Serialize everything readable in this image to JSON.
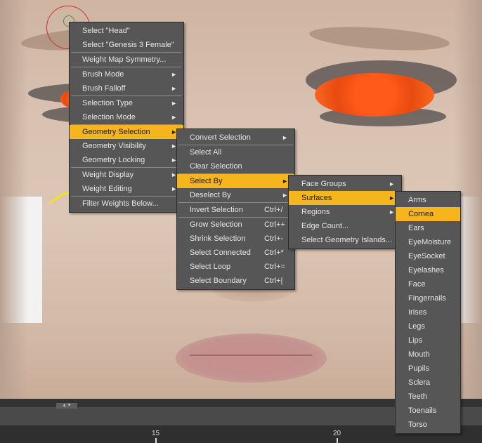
{
  "menu1": {
    "items": [
      {
        "label": "Select \"Head\"",
        "arrow": ""
      },
      {
        "label": "Select \"Genesis 3 Female\"",
        "arrow": ""
      },
      {
        "label": "Weight Map Symmetry...",
        "arrow": ""
      },
      {
        "label": "Brush Mode",
        "arrow": "►"
      },
      {
        "label": "Brush Falloff",
        "arrow": "►"
      },
      {
        "label": "Selection Type",
        "arrow": "►"
      },
      {
        "label": "Selection Mode",
        "arrow": "►"
      },
      {
        "label": "Geometry Selection",
        "arrow": "►"
      },
      {
        "label": "Geometry Visibility",
        "arrow": "►"
      },
      {
        "label": "Geometry Locking",
        "arrow": "►"
      },
      {
        "label": "Weight Display",
        "arrow": "►"
      },
      {
        "label": "Weight Editing",
        "arrow": "►"
      },
      {
        "label": "Filter Weights Below...",
        "arrow": ""
      }
    ]
  },
  "menu2": {
    "items": [
      {
        "label": "Convert Selection",
        "arrow": "►",
        "shortcut": ""
      },
      {
        "label": "Select All",
        "arrow": "",
        "shortcut": ""
      },
      {
        "label": "Clear Selection",
        "arrow": "",
        "shortcut": ""
      },
      {
        "label": "Select By",
        "arrow": "►",
        "shortcut": ""
      },
      {
        "label": "Deselect By",
        "arrow": "►",
        "shortcut": ""
      },
      {
        "label": "Invert Selection",
        "arrow": "",
        "shortcut": "Ctrl+/"
      },
      {
        "label": "Grow Selection",
        "arrow": "",
        "shortcut": "Ctrl++"
      },
      {
        "label": "Shrink Selection",
        "arrow": "",
        "shortcut": "Ctrl+-"
      },
      {
        "label": "Select Connected",
        "arrow": "",
        "shortcut": "Ctrl+*"
      },
      {
        "label": "Select Loop",
        "arrow": "",
        "shortcut": "Ctrl+="
      },
      {
        "label": "Select Boundary",
        "arrow": "",
        "shortcut": "Ctrl+|"
      }
    ]
  },
  "menu3": {
    "items": [
      {
        "label": "Face Groups",
        "arrow": "►"
      },
      {
        "label": "Surfaces",
        "arrow": "►"
      },
      {
        "label": "Regions",
        "arrow": "►"
      },
      {
        "label": "Edge Count...",
        "arrow": ""
      },
      {
        "label": "Select Geometry Islands...",
        "arrow": ""
      }
    ]
  },
  "menu4": {
    "items": [
      "Arms",
      "Cornea",
      "Ears",
      "EyeMoisture",
      "EyeSocket",
      "Eyelashes",
      "Face",
      "Fingernails",
      "Irises",
      "Legs",
      "Lips",
      "Mouth",
      "Pupils",
      "Sclera",
      "Teeth",
      "Toenails",
      "Torso"
    ]
  },
  "timeline": {
    "ticks": [
      "15",
      "20"
    ]
  },
  "colors": {
    "highlight": "#f5b61d",
    "menu_bg": "#565656",
    "annotation": "#f5e21a"
  }
}
